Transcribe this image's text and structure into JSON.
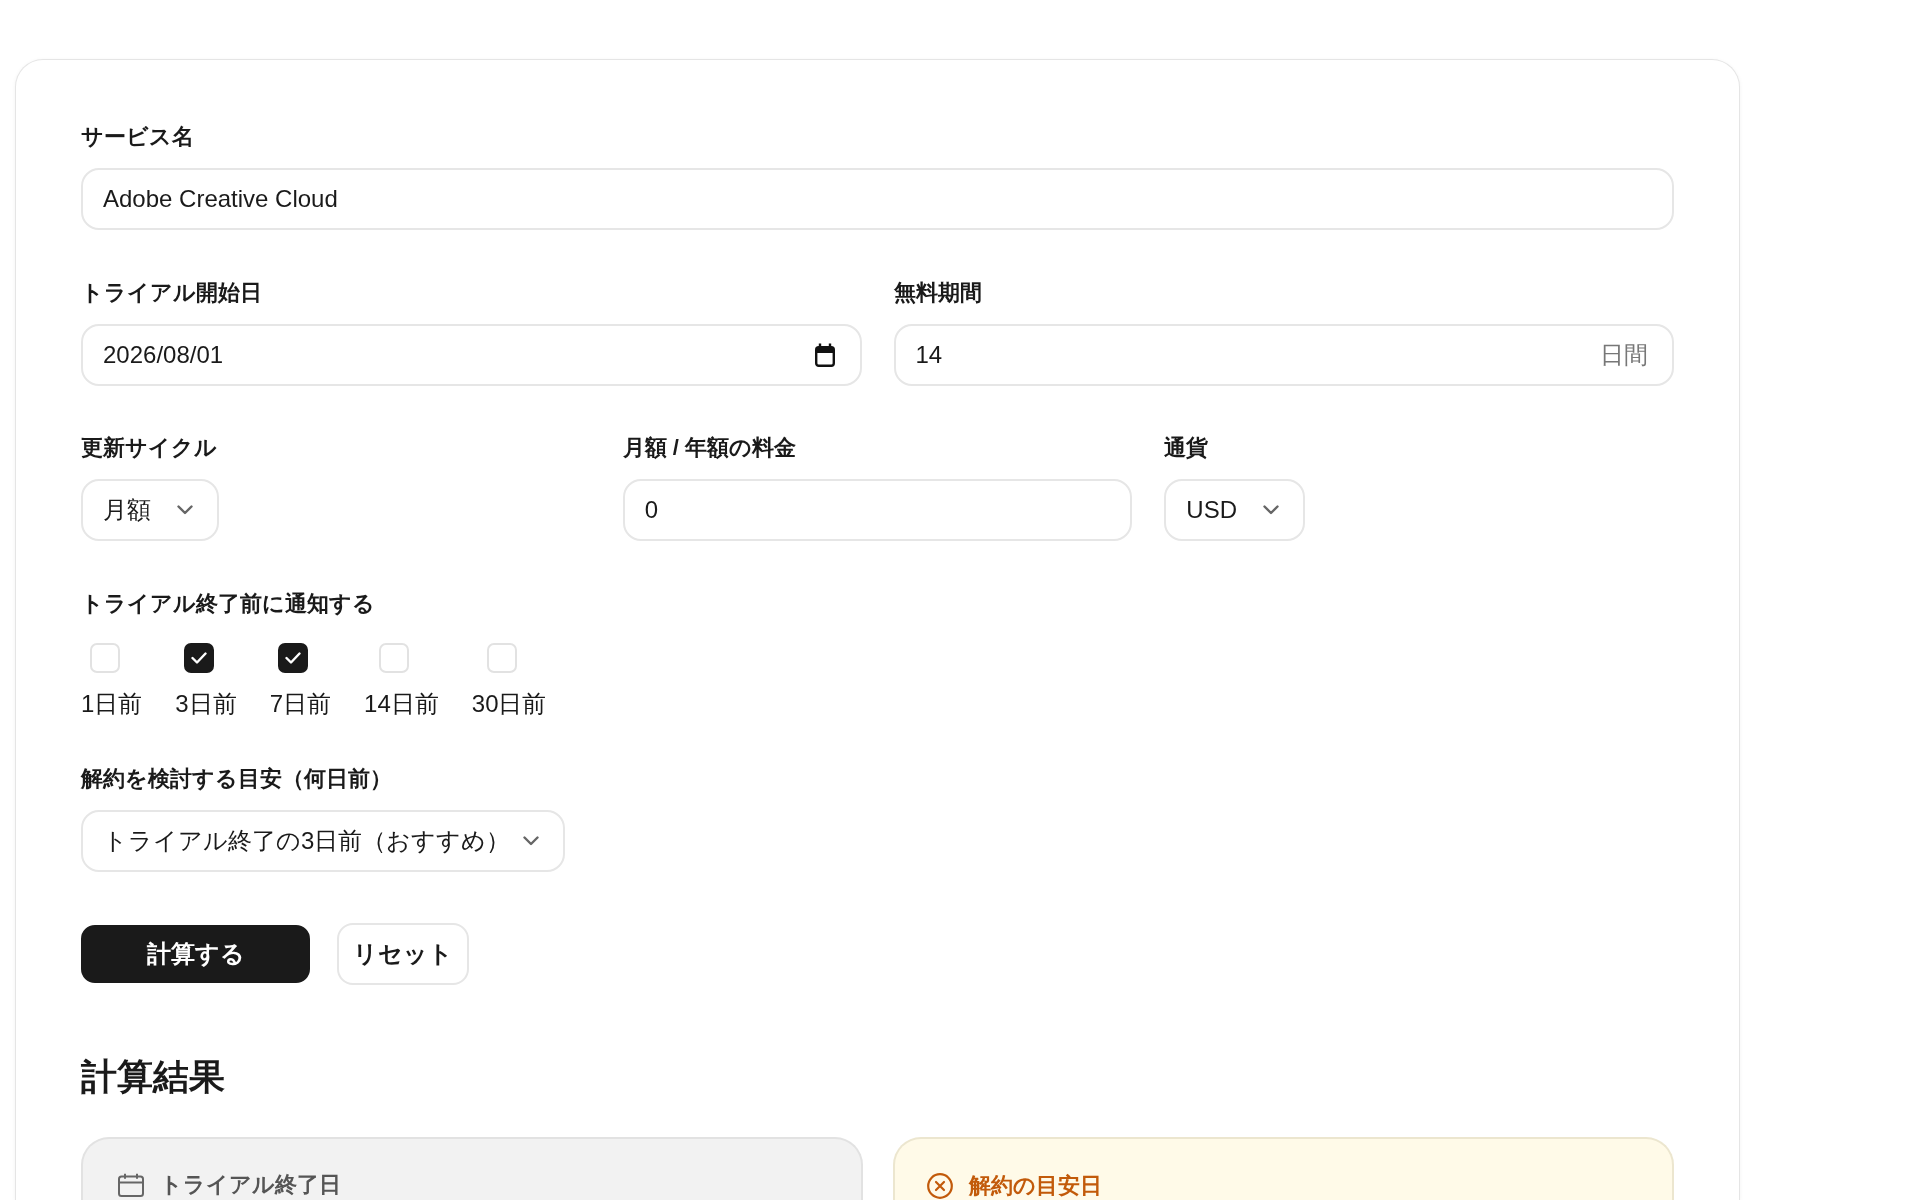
{
  "form": {
    "service_name": {
      "label": "サービス名",
      "value": "Adobe Creative Cloud"
    },
    "trial_start": {
      "label": "トライアル開始日",
      "value": "2026/08/01"
    },
    "free_period": {
      "label": "無料期間",
      "value": "14",
      "unit": "日間"
    },
    "renewal_cycle": {
      "label": "更新サイクル",
      "value": "月額"
    },
    "price": {
      "label": "月額 / 年額の料金",
      "value": "0"
    },
    "currency": {
      "label": "通貨",
      "value": "USD"
    },
    "notify": {
      "label": "トライアル終了前に通知する",
      "options": [
        {
          "label": "1日前",
          "checked": false
        },
        {
          "label": "3日前",
          "checked": true
        },
        {
          "label": "7日前",
          "checked": true
        },
        {
          "label": "14日前",
          "checked": false
        },
        {
          "label": "30日前",
          "checked": false
        }
      ]
    },
    "cancel_timing": {
      "label": "解約を検討する目安（何日前）",
      "value": "トライアル終了の3日前（おすすめ）"
    },
    "buttons": [
      {
        "label": "計算する",
        "kind": "primary"
      },
      {
        "label": "リセット",
        "kind": "secondary"
      }
    ]
  },
  "results": {
    "title": "計算結果",
    "cards": [
      {
        "label": "トライアル終了日",
        "kind": "neutral"
      },
      {
        "label": "解約の目安日",
        "kind": "warning"
      }
    ]
  }
}
